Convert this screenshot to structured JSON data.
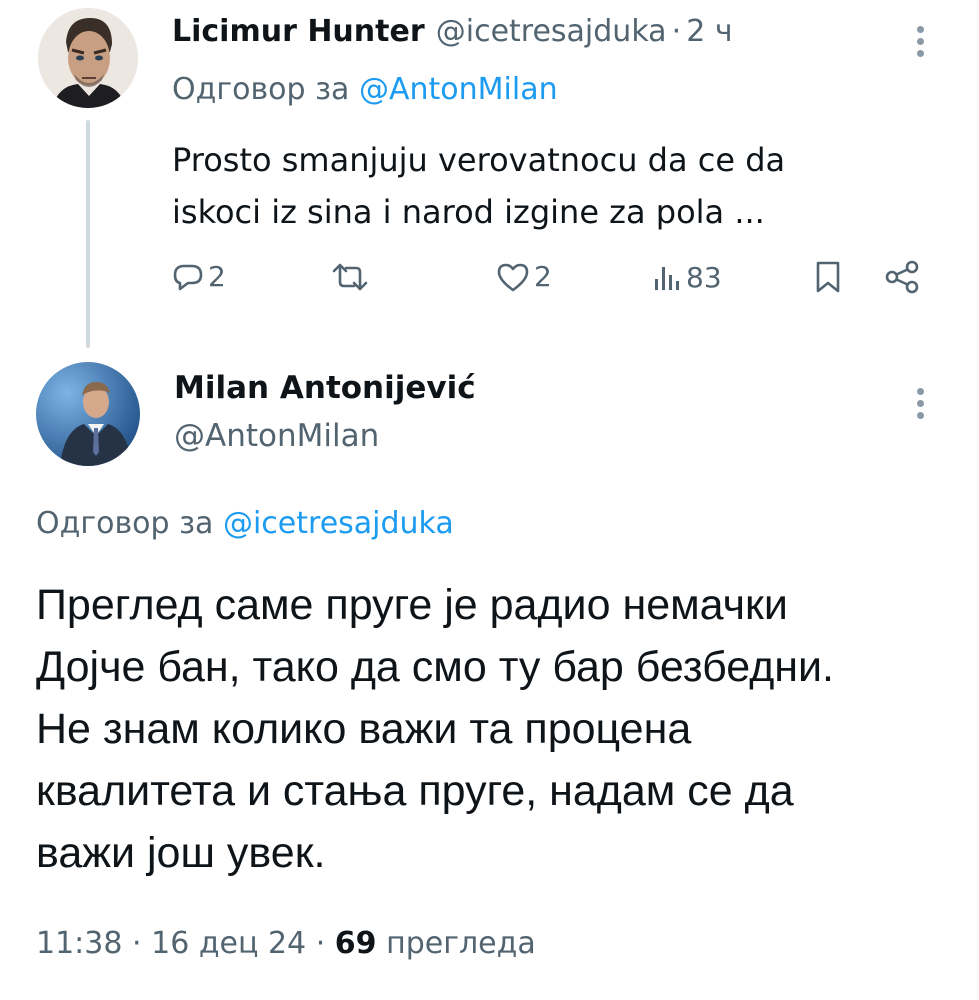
{
  "reply_tweet": {
    "author_name": "Licimur Hunter",
    "author_handle": "@icetresajduka",
    "separator": "·",
    "time": "2 ч",
    "reply_prefix": "Одговор за",
    "reply_to": "@AntonMilan",
    "text_line1": "Prosto smanjuju verovatnocu da ce da",
    "text_line2": "iskoci iz sina i narod izgine za pola ...",
    "actions": {
      "replies": "2",
      "likes": "2",
      "views": "83"
    },
    "icons": [
      "reply-icon",
      "retweet-icon",
      "like-icon",
      "views-icon",
      "bookmark-icon",
      "share-icon",
      "more-icon"
    ]
  },
  "main_tweet": {
    "author_name": "Milan Antonijević",
    "author_handle": "@AntonMilan",
    "reply_prefix": "Одговор за",
    "reply_to": "@icetresajduka",
    "text_lines": [
      "Преглед саме пруге је радио немачки",
      "Дојче бан, тако да смо ту бар безбедни.",
      "Не знам колико важи та процена",
      "квалитета и стања пруге, надам се да",
      "важи још увек."
    ],
    "time": "11:38",
    "date": "16 дец 24",
    "separator": "·",
    "views_count": "69",
    "views_label": "прегледа"
  },
  "colors": {
    "text": "#0f1419",
    "secondary": "#536471",
    "link": "#1d9bf0",
    "thread_line": "#cfd9de"
  }
}
